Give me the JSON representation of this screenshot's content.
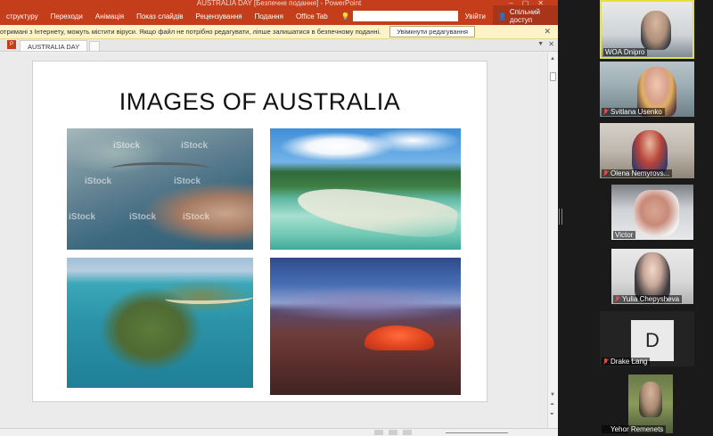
{
  "window": {
    "title": "AUSTRALIA DAY [Безпечне подання] - PowerPoint"
  },
  "ribbon": {
    "tabs": [
      "структуру",
      "Переходи",
      "Анімація",
      "Показ слайдів",
      "Рецензування",
      "Подання",
      "Office Tab"
    ],
    "signin": "Увійти",
    "share": "Спільний доступ"
  },
  "protected_view": {
    "message": "отримані з Інтернету, можуть містити віруси. Якщо файл не потрібно редагувати, ліпше залишатися в безпечному поданні.",
    "enable_button": "Увімкнути редагування"
  },
  "doc_tabs": {
    "active": "AUSTRALIA DAY"
  },
  "slide": {
    "title": "IMAGES OF AUSTRALIA",
    "watermark": "iStock"
  },
  "colors": {
    "accent": "#c43e1c",
    "active_speaker": "#e6e23c",
    "muted_mic": "#e34b4b"
  },
  "participants": [
    {
      "name": "WOA Dnipro",
      "muted": false,
      "active": true
    },
    {
      "name": "Svitlana Usenko",
      "muted": true
    },
    {
      "name": "Olena Nemyrovs...",
      "muted": true
    },
    {
      "name": "Victor",
      "muted": false
    },
    {
      "name": "Yulia Chepysheva",
      "muted": true
    },
    {
      "name": "Drake Lang",
      "muted": true,
      "avatar_initial": "D"
    },
    {
      "name": "Yehor Remenets",
      "muted": true
    }
  ]
}
